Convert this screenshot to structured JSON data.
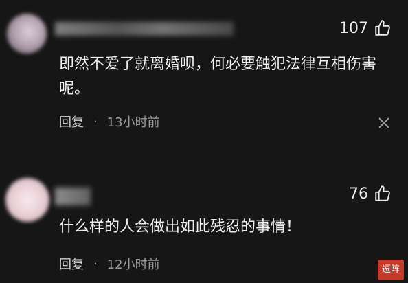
{
  "comments": [
    {
      "likes": "107",
      "text": "即然不爱了就离婚呗，何必要触犯法律互相伤害呢。",
      "reply_label": "回复",
      "separator": "·",
      "time": "13小时前"
    },
    {
      "likes": "76",
      "text": "什么样的人会做出如此残忍的事情！",
      "reply_label": "回复",
      "separator": "·",
      "time": "12小时前"
    }
  ],
  "watermark": "逗阵",
  "icons": {
    "like": "thumbs-up-icon",
    "close": "close-icon"
  },
  "colors": {
    "background": "#161616",
    "text": "#eeeeee",
    "meta": "#9a9a9a"
  }
}
